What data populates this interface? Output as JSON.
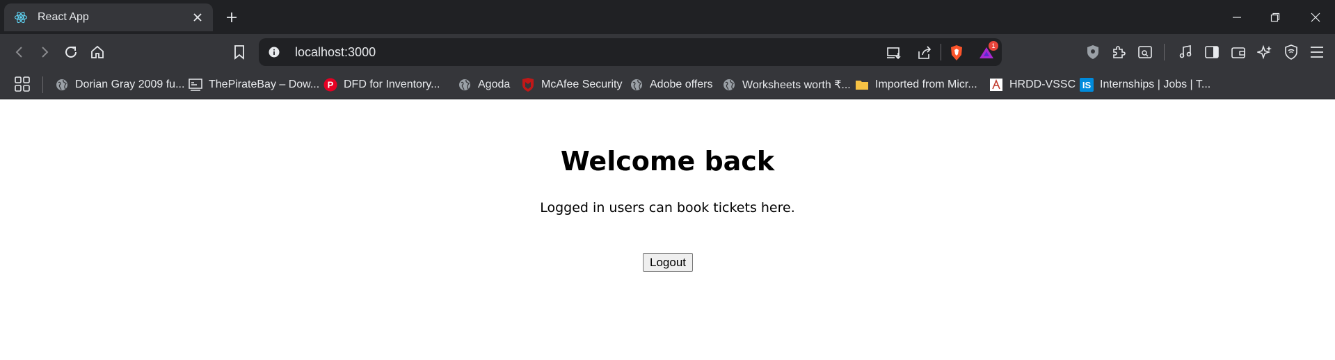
{
  "browser": {
    "tab": {
      "title": "React App"
    },
    "address_bar": {
      "url": "localhost:3000"
    },
    "notification_count": "1",
    "bookmarks": [
      {
        "label": "Dorian Gray 2009 fu...",
        "icon": "globe-icon"
      },
      {
        "label": "ThePirateBay – Dow...",
        "icon": "pirate-ship-icon"
      },
      {
        "label": "DFD for Inventory...",
        "icon": "pinterest-icon"
      },
      {
        "label": "Agoda",
        "icon": "globe-icon"
      },
      {
        "label": "McAfee Security",
        "icon": "mcafee-shield-icon"
      },
      {
        "label": "Adobe offers",
        "icon": "globe-icon"
      },
      {
        "label": "Worksheets worth ₹...",
        "icon": "globe-icon"
      },
      {
        "label": "Imported from Micr...",
        "icon": "folder-icon"
      },
      {
        "label": "HRDD-VSSC",
        "icon": "hrdd-logo-icon"
      },
      {
        "label": "Internships | Jobs | T...",
        "icon": "internshala-icon"
      }
    ]
  },
  "page": {
    "heading": "Welcome back",
    "message": "Logged in users can book tickets here.",
    "logout_label": "Logout"
  },
  "colors": {
    "titlebar": "#202124",
    "toolbar": "#35363a",
    "page_background": "#ffffff"
  }
}
